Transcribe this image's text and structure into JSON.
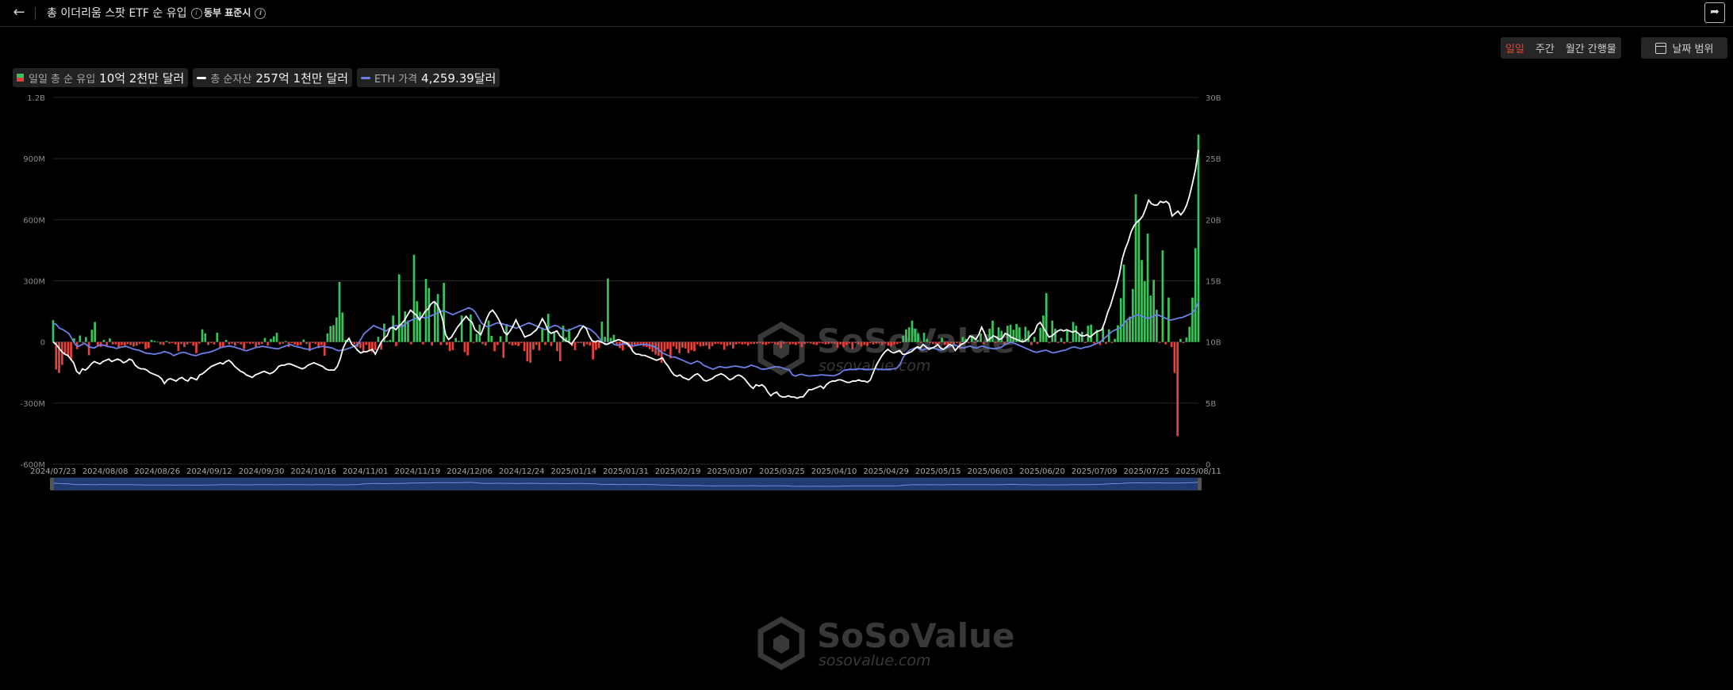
{
  "header": {
    "back_icon": "arrow-left-icon",
    "title": "총 이더리움 스팟 ETF 순 유입",
    "timezone": "동부 표준시",
    "share_icon": "share-icon"
  },
  "controls": {
    "tabs": [
      {
        "label": "일일",
        "active": true
      },
      {
        "label": "주간",
        "active": false
      },
      {
        "label": "월간 간행물",
        "active": false
      }
    ],
    "date_range_label": "날짜 범위"
  },
  "legend": [
    {
      "label": "일일 총 순 유입",
      "value": "10억 2천만 달러",
      "color": "#3ac35a"
    },
    {
      "label": "총 순자산",
      "value": "257억 1천만 달러",
      "color": "#ffffff"
    },
    {
      "label": "ETH 가격",
      "value": "4,259.39달러",
      "color": "#6b7fe8"
    }
  ],
  "watermark": {
    "brand": "SoSoValue",
    "url": "sosovalue.com"
  },
  "colors": {
    "positive": "#3ac35a",
    "negative": "#e8413a",
    "assets_line": "#ffffff",
    "eth_line": "#6b7fe8",
    "active_tab": "#e8412f"
  },
  "chart_data": {
    "type": "bar",
    "left_axis": {
      "ticks": [
        "1.2B",
        "900M",
        "600M",
        "300M",
        "0",
        "-300M",
        "-600M"
      ],
      "range": [
        -600,
        1200
      ],
      "unit": "M USD"
    },
    "right_axis": {
      "ticks": [
        "30B",
        "25B",
        "20B",
        "15B",
        "10B",
        "5B",
        "0"
      ],
      "range": [
        0,
        30
      ],
      "unit": "B USD"
    },
    "x_ticks": [
      "2024/07/23",
      "2024/08/08",
      "2024/08/26",
      "2024/09/12",
      "2024/09/30",
      "2024/10/16",
      "2024/11/01",
      "2024/11/19",
      "2024/12/06",
      "2024/12/24",
      "2025/01/14",
      "2025/01/31",
      "2025/02/19",
      "2025/03/07",
      "2025/03/25",
      "2025/04/10",
      "2025/04/29",
      "2025/05/15",
      "2025/06/03",
      "2025/06/20",
      "2025/07/09",
      "2025/07/25",
      "2025/08/11"
    ],
    "series": [
      {
        "name": "일일 총 순 유입",
        "kind": "bar",
        "axis": "left",
        "values_million": [
          107,
          -135,
          -152,
          -113,
          -55,
          -68,
          -90,
          18,
          -35,
          32,
          -5,
          24,
          -65,
          60,
          98,
          -22,
          -25,
          10,
          -18,
          18,
          -12,
          -12,
          -32,
          -15,
          -18,
          -10,
          -15,
          -22,
          -18,
          -10,
          -8,
          -35,
          -30,
          10,
          5,
          0,
          -12,
          -15,
          5,
          -8,
          -5,
          -12,
          -45,
          -10,
          -25,
          -12,
          -5,
          -18,
          -55,
          -8,
          62,
          42,
          -15,
          -5,
          -12,
          45,
          -30,
          -22,
          10,
          -12,
          -8,
          -18,
          -5,
          -12,
          -35,
          -5,
          -10,
          -8,
          -25,
          -15,
          -10,
          20,
          -18,
          15,
          28,
          45,
          -12,
          -8,
          5,
          -25,
          -5,
          -12,
          -18,
          -15,
          12,
          -10,
          -45,
          -5,
          -10,
          -30,
          -15,
          -68,
          42,
          78,
          82,
          120,
          295,
          145,
          10,
          5,
          -5,
          -12,
          -25,
          -30,
          -48,
          -15,
          -45,
          -50,
          -40,
          25,
          -38,
          90,
          5,
          10,
          130,
          -20,
          332,
          88,
          150,
          105,
          -12,
          428,
          200,
          148,
          -12,
          310,
          265,
          -18,
          200,
          235,
          -15,
          290,
          -15,
          -45,
          -40,
          20,
          5,
          130,
          -50,
          -66,
          135,
          -5,
          40,
          85,
          -10,
          -18,
          105,
          30,
          -45,
          -15,
          28,
          -78,
          88,
          -10,
          -18,
          -15,
          -20,
          -5,
          -45,
          -95,
          -102,
          -38,
          -15,
          -42,
          70,
          -15,
          138,
          -20,
          45,
          -45,
          -95,
          80,
          22,
          65,
          -20,
          -40,
          -5,
          -5,
          -22,
          -12,
          -18,
          -86,
          -40,
          -30,
          100,
          25,
          312,
          20,
          35,
          -12,
          -30,
          -42,
          -15,
          -25,
          -35,
          -15,
          -15,
          -10,
          -22,
          -25,
          -35,
          -48,
          -62,
          -68,
          -102,
          -48,
          -35,
          -80,
          -22,
          -35,
          -55,
          -28,
          -32,
          -55,
          -40,
          -45,
          -12,
          -22,
          -20,
          -18,
          -35,
          -20,
          -10,
          -8,
          -12,
          -38,
          -20,
          -15,
          -32,
          -12,
          -8,
          -12,
          -10,
          -18,
          -10,
          -10,
          -8,
          -5,
          -12,
          -15,
          -8,
          -5,
          -12,
          -15,
          -30,
          -8,
          -5,
          -12,
          -10,
          -15,
          -8,
          -25,
          -10,
          -5,
          -8,
          -12,
          -15,
          -5,
          -8,
          -12,
          -10,
          -5,
          -8,
          -28,
          -12,
          -25,
          -15,
          -8,
          -35,
          -5,
          -12,
          -22,
          -15,
          -20,
          -5,
          -12,
          -8,
          -5,
          -15,
          -8,
          -18,
          -22,
          -12,
          -10,
          -5,
          30,
          62,
          72,
          105,
          65,
          42,
          -5,
          45,
          15,
          -5,
          -10,
          -12,
          -8,
          20,
          -15,
          -25,
          -8,
          -12,
          -5,
          -35,
          25,
          15,
          -5,
          32,
          -5,
          10,
          42,
          -12,
          18,
          65,
          105,
          -5,
          72,
          55,
          -15,
          80,
          85,
          60,
          88,
          72,
          15,
          75,
          55,
          -15,
          25,
          -10,
          70,
          130,
          240,
          -5,
          105,
          65,
          -5,
          20,
          -8,
          60,
          -5,
          98,
          80,
          35,
          50,
          -5,
          80,
          85,
          -8,
          60,
          -15,
          70,
          -10,
          62,
          -5,
          15,
          82,
          215,
          380,
          102,
          125,
          260,
          725,
          602,
          402,
          298,
          532,
          228,
          305,
          158,
          -5,
          450,
          -12,
          218,
          -25,
          -152,
          -462,
          15,
          -5,
          22,
          75,
          218,
          460,
          1018
        ]
      },
      {
        "name": "총 순자산",
        "kind": "line",
        "axis": "right",
        "values_billion": [
          10.0,
          9.8,
          9.5,
          9.2,
          9.0,
          8.9,
          8.6,
          8.3,
          7.6,
          7.4,
          7.8,
          7.7,
          7.9,
          8.2,
          8.4,
          8.3,
          8.2,
          8.4,
          8.5,
          8.6,
          8.4,
          8.5,
          8.6,
          8.5,
          8.3,
          8.4,
          8.6,
          8.5,
          8.1,
          7.9,
          7.8,
          7.8,
          7.7,
          7.5,
          7.4,
          7.3,
          7.2,
          7.0,
          6.6,
          6.9,
          7.0,
          6.9,
          6.8,
          7.0,
          7.1,
          6.9,
          6.8,
          7.1,
          7.0,
          6.9,
          7.3,
          7.4,
          7.6,
          7.8,
          8.0,
          8.1,
          8.2,
          8.3,
          8.2,
          8.4,
          8.5,
          8.3,
          8.0,
          7.8,
          7.6,
          7.5,
          7.3,
          7.2,
          7.1,
          7.3,
          7.4,
          7.5,
          7.6,
          7.5,
          7.4,
          7.5,
          7.7,
          8.0,
          8.1,
          8.1,
          8.2,
          8.2,
          8.1,
          8.0,
          7.9,
          7.8,
          7.9,
          8.1,
          8.2,
          8.3,
          8.2,
          8.1,
          8.0,
          7.8,
          7.7,
          7.7,
          7.7,
          8.0,
          8.6,
          9.5,
          10.0,
          10.3,
          9.8,
          9.6,
          9.3,
          9.1,
          9.2,
          9.2,
          9.3,
          9.4,
          9.0,
          9.5,
          10.0,
          10.3,
          10.5,
          11.1,
          11.2,
          11.0,
          11.3,
          11.5,
          11.8,
          12.2,
          12.6,
          12.4,
          12.2,
          11.8,
          12.1,
          12.5,
          12.7,
          13.1,
          13.3,
          13.1,
          12.6,
          11.8,
          10.6,
          10.2,
          10.4,
          10.8,
          11.2,
          11.5,
          11.8,
          12.1,
          11.8,
          11.6,
          11.0,
          10.8,
          10.6,
          11.2,
          11.9,
          12.4,
          12.6,
          12.3,
          11.9,
          11.4,
          10.8,
          10.6,
          10.9,
          11.3,
          11.8,
          11.3,
          10.9,
          10.4,
          10.5,
          10.6,
          10.8,
          11.0,
          11.4,
          11.9,
          11.5,
          10.9,
          10.7,
          10.8,
          10.9,
          10.5,
          10.3,
          10.1,
          10.0,
          9.8,
          10.2,
          10.5,
          11.0,
          11.3,
          11.1,
          10.5,
          10.1,
          10.0,
          10.1,
          10.0,
          9.9,
          9.8,
          9.9,
          10.0,
          10.1,
          10.2,
          10.1,
          10.0,
          9.9,
          9.6,
          9.2,
          9.0,
          9.0,
          8.9,
          8.9,
          8.8,
          8.7,
          8.6,
          8.5,
          8.6,
          8.7,
          8.3,
          8.0,
          7.6,
          7.3,
          7.2,
          7.3,
          7.1,
          7.0,
          6.9,
          7.1,
          7.3,
          7.4,
          7.2,
          6.9,
          6.8,
          6.9,
          7.0,
          7.2,
          7.3,
          7.4,
          7.3,
          7.1,
          6.9,
          7.0,
          7.2,
          7.3,
          7.2,
          7.0,
          6.7,
          6.4,
          6.2,
          6.5,
          6.4,
          6.5,
          6.3,
          5.9,
          5.6,
          5.8,
          5.9,
          5.6,
          5.5,
          5.5,
          5.6,
          5.5,
          5.5,
          5.4,
          5.5,
          5.5,
          5.8,
          6.1,
          6.1,
          6.2,
          6.3,
          6.4,
          6.2,
          6.5,
          6.7,
          6.8,
          6.8,
          6.9,
          6.9,
          6.8,
          6.7,
          6.7,
          6.8,
          6.8,
          6.9,
          6.8,
          6.8,
          6.7,
          6.9,
          7.5,
          8.1,
          8.5,
          8.9,
          9.2,
          9.4,
          9.2,
          9.1,
          9.2,
          9.3,
          9.0,
          9.0,
          9.1,
          9.2,
          9.4,
          9.6,
          9.5,
          9.8,
          9.6,
          9.4,
          9.5,
          9.6,
          9.8,
          9.5,
          9.4,
          9.6,
          9.8,
          9.7,
          9.3,
          9.6,
          9.8,
          9.9,
          10.1,
          10.5,
          10.4,
          10.2,
          10.6,
          11.2,
          10.7,
          10.1,
          10.3,
          10.5,
          10.4,
          10.2,
          10.3,
          10.7,
          10.6,
          10.4,
          10.3,
          10.2,
          10.1,
          10.0,
          10.1,
          10.3,
          10.6,
          10.8,
          11.4,
          11.6,
          11.2,
          10.8,
          10.4,
          10.5,
          10.7,
          10.9,
          11.0,
          10.9,
          11.0,
          10.9,
          10.8,
          10.9,
          10.7,
          10.5,
          10.5,
          10.6,
          10.4,
          10.6,
          10.8,
          10.9,
          11.0,
          11.6,
          12.4,
          13.0,
          13.8,
          14.6,
          15.5,
          16.8,
          17.6,
          18.2,
          19.0,
          19.5,
          19.8,
          20.0,
          20.3,
          20.9,
          21.6,
          21.3,
          21.2,
          21.2,
          21.5,
          21.4,
          21.5,
          21.3,
          20.3,
          20.5,
          20.7,
          20.4,
          20.7,
          21.2,
          22.0,
          23.0,
          24.1,
          25.7
        ]
      },
      {
        "name": "ETH 가격",
        "kind": "line",
        "axis": "left_scaled",
        "values_usd": [
          3480,
          3440,
          3300,
          3260,
          3180,
          3100,
          2900,
          2700,
          2640,
          2700,
          2750,
          2650,
          2600,
          2580,
          2650,
          2700,
          2680,
          2640,
          2620,
          2600,
          2560,
          2600,
          2620,
          2640,
          2600,
          2550,
          2520,
          2500,
          2450,
          2400,
          2380,
          2370,
          2350,
          2380,
          2400,
          2450,
          2420,
          2380,
          2300,
          2350,
          2400,
          2420,
          2400,
          2350,
          2320,
          2300,
          2340,
          2380,
          2400,
          2420,
          2450,
          2500,
          2550,
          2600,
          2620,
          2650,
          2640,
          2620,
          2580,
          2550,
          2500,
          2480,
          2520,
          2560,
          2600,
          2620,
          2640,
          2620,
          2600,
          2580,
          2560,
          2550,
          2600,
          2640,
          2680,
          2700,
          2650,
          2620,
          2600,
          2560,
          2540,
          2520,
          2560,
          2600,
          2620,
          2640,
          2620,
          2600,
          2580,
          2520,
          2480,
          2500,
          2520,
          2560,
          2600,
          2650,
          2700,
          2900,
          3100,
          3200,
          3300,
          3400,
          3350,
          3300,
          3250,
          3200,
          3300,
          3350,
          3400,
          3380,
          3350,
          3450,
          3550,
          3600,
          3650,
          3700,
          3720,
          3680,
          3700,
          3750,
          3800,
          3850,
          3900,
          3950,
          3900,
          3850,
          3800,
          3850,
          3900,
          3950,
          4000,
          4050,
          4000,
          3900,
          3700,
          3500,
          3400,
          3350,
          3400,
          3450,
          3500,
          3480,
          3450,
          3420,
          3380,
          3350,
          3300,
          3350,
          3400,
          3450,
          3500,
          3450,
          3400,
          3350,
          3300,
          3250,
          3300,
          3350,
          3400,
          3380,
          3300,
          3250,
          3200,
          3250,
          3300,
          3350,
          3400,
          3380,
          3320,
          3280,
          3200,
          3100,
          2950,
          2800,
          2700,
          2750,
          2800,
          2700,
          2680,
          2700,
          2750,
          2700,
          2680,
          2650,
          2680,
          2700,
          2720,
          2700,
          2680,
          2650,
          2600,
          2500,
          2400,
          2350,
          2300,
          2250,
          2250,
          2200,
          2150,
          2100,
          2050,
          2000,
          2050,
          2100,
          2050,
          1950,
          1900,
          1850,
          1800,
          1850,
          1900,
          1880,
          1860,
          1880,
          1900,
          1920,
          1900,
          1880,
          1860,
          1900,
          1950,
          1920,
          1880,
          1820,
          1800,
          1820,
          1850,
          1880,
          1900,
          1880,
          1850,
          1800,
          1780,
          1600,
          1550,
          1600,
          1620,
          1580,
          1560,
          1560,
          1570,
          1580,
          1600,
          1590,
          1580,
          1570,
          1560,
          1600,
          1650,
          1750,
          1780,
          1800,
          1790,
          1800,
          1820,
          1810,
          1800,
          1790,
          1800,
          1820,
          1810,
          1800,
          1790,
          1800,
          1810,
          1820,
          1850,
          2000,
          2250,
          2400,
          2500,
          2550,
          2600,
          2550,
          2500,
          2550,
          2600,
          2580,
          2560,
          2520,
          2500,
          2550,
          2600,
          2650,
          2700,
          2650,
          2600,
          2580,
          2620,
          2650,
          2600,
          2580,
          2620,
          2650,
          2600,
          2580,
          2560,
          2550,
          2580,
          2620,
          2700,
          2750,
          2800,
          2750,
          2700,
          2650,
          2600,
          2550,
          2500,
          2450,
          2420,
          2450,
          2480,
          2500,
          2450,
          2400,
          2420,
          2450,
          2480,
          2500,
          2550,
          2600,
          2620,
          2580,
          2560,
          2600,
          2620,
          2650,
          2700,
          2750,
          2800,
          2900,
          3000,
          3100,
          3200,
          3250,
          3300,
          3400,
          3550,
          3650,
          3700,
          3750,
          3800,
          3750,
          3700,
          3650,
          3700,
          3750,
          3800,
          3750,
          3700,
          3650,
          3600,
          3620,
          3650,
          3680,
          3700,
          3750,
          3800,
          3850,
          4000,
          4259
        ]
      }
    ]
  }
}
